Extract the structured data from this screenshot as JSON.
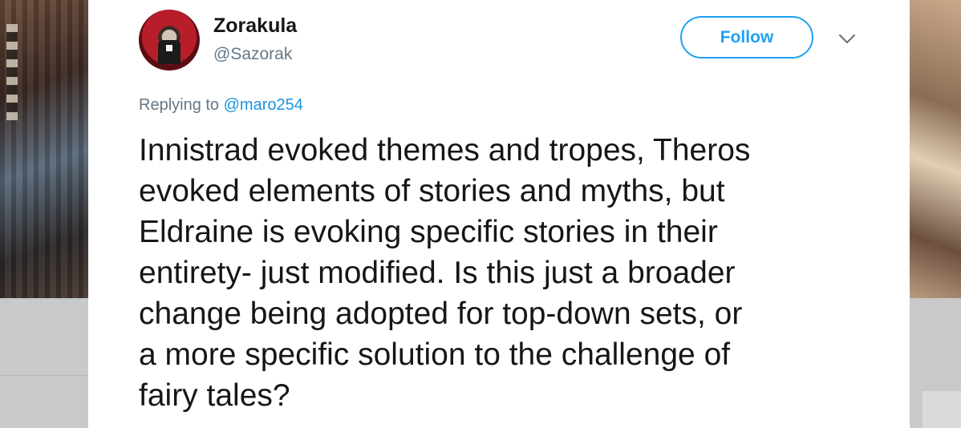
{
  "tweet": {
    "author_name": "Zorakula",
    "author_handle": "@Sazorak",
    "follow_label": "Follow",
    "replying_prefix": "Replying to",
    "replying_handle": "@maro254",
    "text": "Innistrad evoked themes and tropes, Theros\nevoked elements of stories and myths, but\nEldraine is evoking specific stories in their\nentirety- just modified. Is this just a broader\nchange being adopted for top-down sets, or\na more specific solution to the challenge of\nfairy tales?"
  },
  "icons": {
    "menu": "chevron-down-icon",
    "avatar": "profile-avatar"
  },
  "colors": {
    "accent": "#1da1f2",
    "link": "#1b95e0",
    "secondary_text": "#657786",
    "primary_text": "#14171a"
  }
}
